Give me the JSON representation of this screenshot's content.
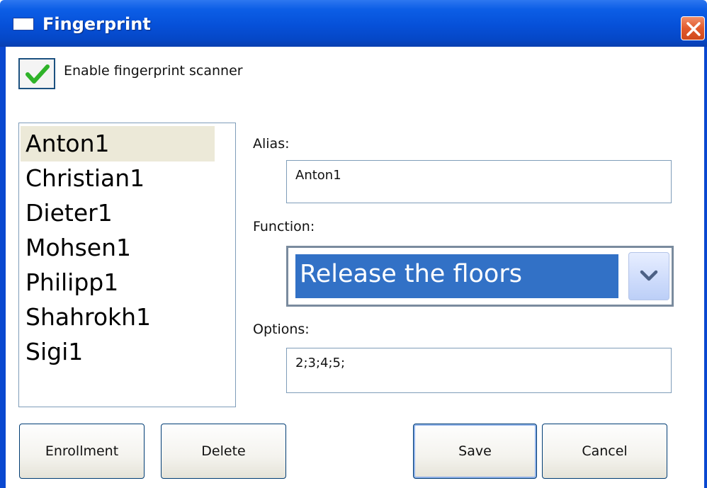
{
  "window": {
    "title": "Fingerprint"
  },
  "enable_scanner": {
    "label": "Enable fingerprint scanner",
    "checked": true
  },
  "users": {
    "items": [
      "Anton1",
      "Christian1",
      "Dieter1",
      "Mohsen1",
      "Philipp1",
      "Shahrokh1",
      "Sigi1"
    ],
    "selected": "Anton1"
  },
  "alias": {
    "label": "Alias:",
    "value": "Anton1"
  },
  "function": {
    "label": "Function:",
    "selected": "Release the floors"
  },
  "options": {
    "label": "Options:",
    "value": "2;3;4;5;"
  },
  "buttons": {
    "enrollment": "Enrollment",
    "delete": "Delete",
    "save": "Save",
    "cancel": "Cancel"
  },
  "colors": {
    "titlebar": "#0650d8",
    "selection": "#3271c6",
    "check": "#2fb32a",
    "close": "#e25a2c"
  }
}
